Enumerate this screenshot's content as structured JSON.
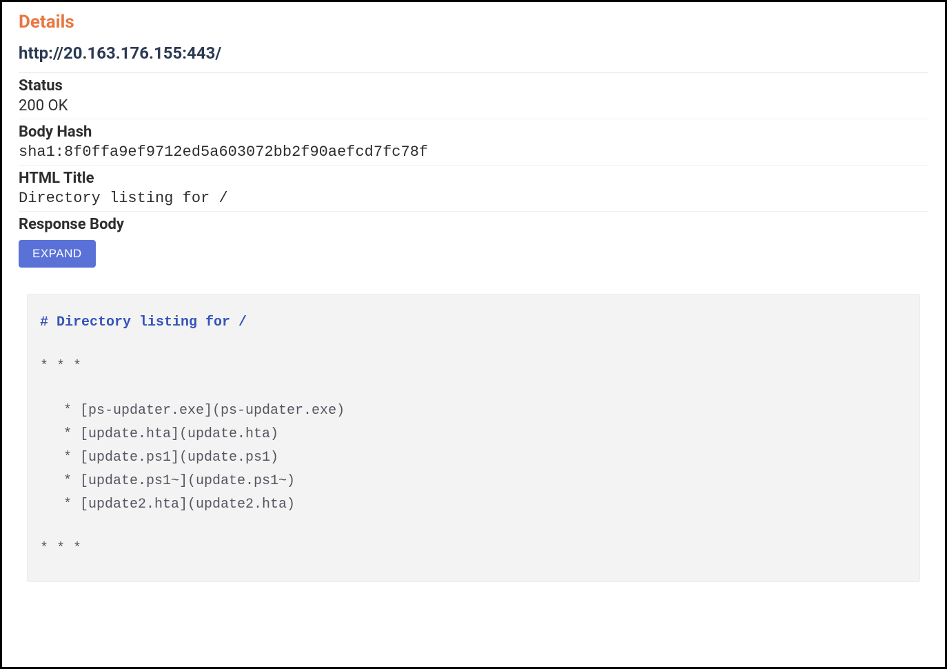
{
  "header": {
    "title": "Details",
    "url": "http://20.163.176.155:443/"
  },
  "fields": {
    "status_label": "Status",
    "status_value": "200 OK",
    "body_hash_label": "Body Hash",
    "body_hash_value": "sha1:8f0ffa9ef9712ed5a603072bb2f90aefcd7fc78f",
    "html_title_label": "HTML Title",
    "html_title_value": "Directory listing for /",
    "response_body_label": "Response Body"
  },
  "buttons": {
    "expand": "EXPAND"
  },
  "response": {
    "heading": "# Directory listing for /",
    "separator_top": "* * *",
    "files": [
      "* [ps-updater.exe](ps-updater.exe)",
      "* [update.hta](update.hta)",
      "* [update.ps1](update.ps1)",
      "* [update.ps1~](update.ps1~)",
      "* [update2.hta](update2.hta)"
    ],
    "separator_bottom": "* * *"
  }
}
